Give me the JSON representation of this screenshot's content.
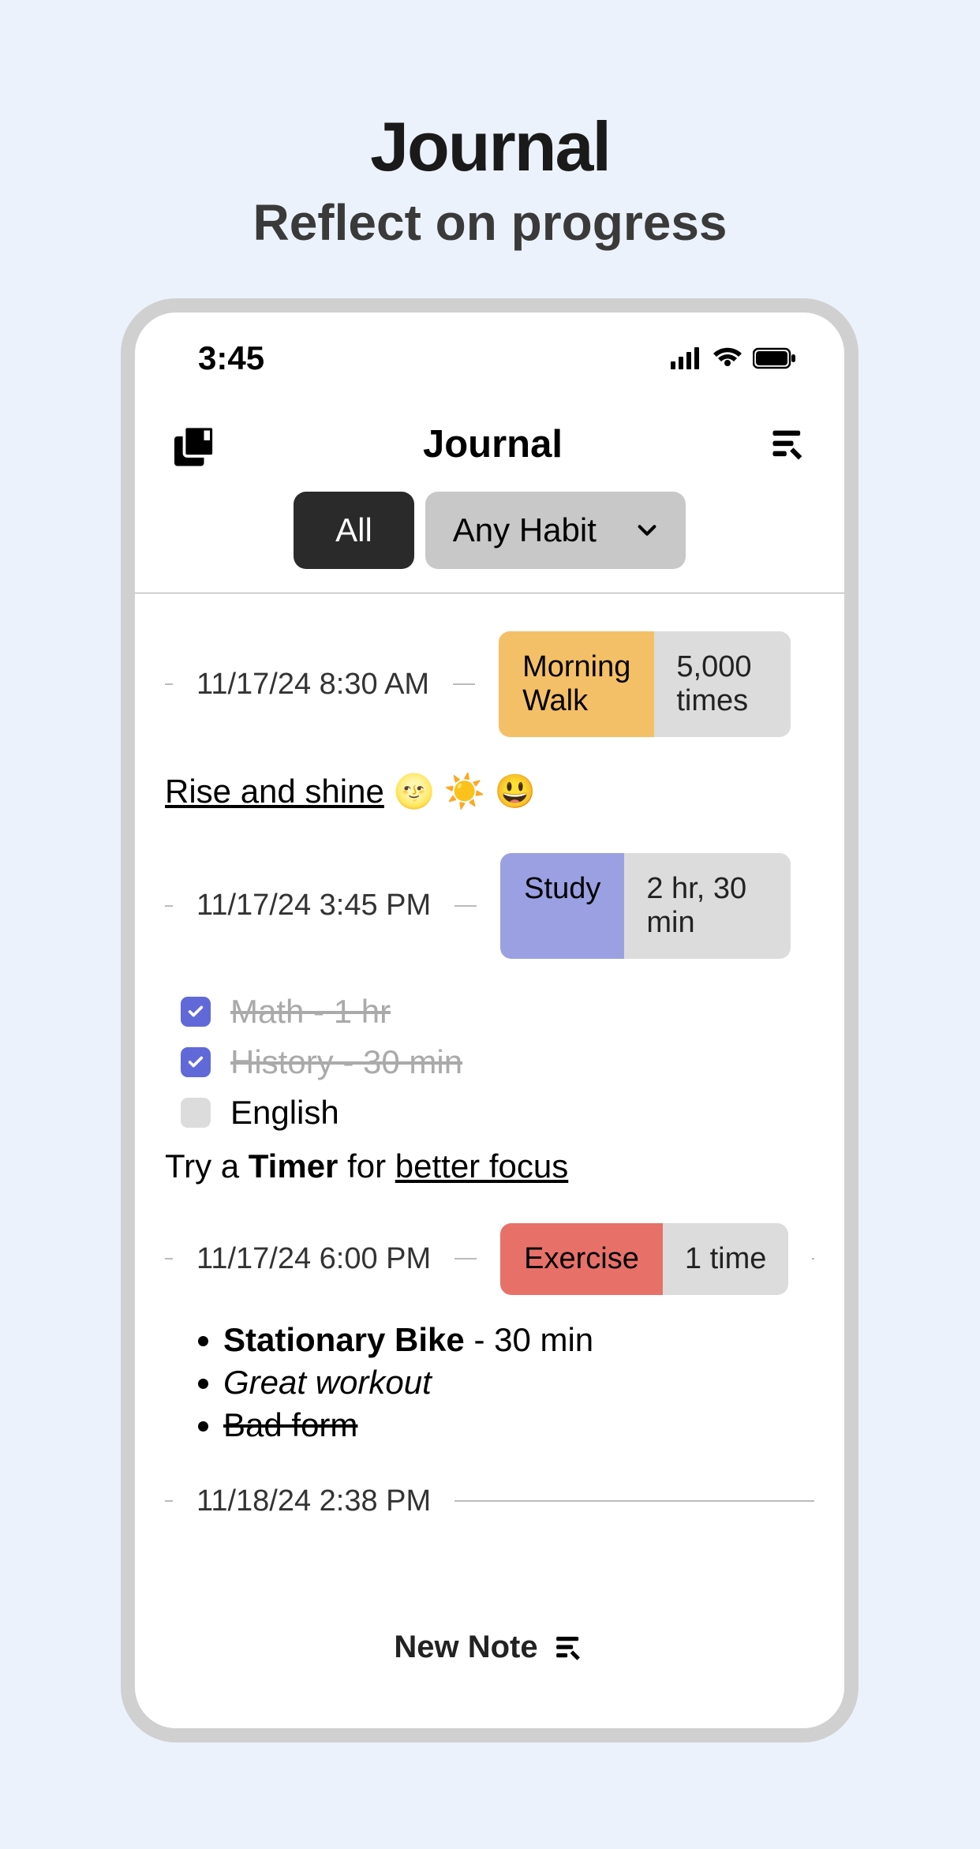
{
  "promo": {
    "title": "Journal",
    "subtitle": "Reflect on progress"
  },
  "status_bar": {
    "time": "3:45"
  },
  "header": {
    "title": "Journal"
  },
  "filters": {
    "all_label": "All",
    "habit_label": "Any Habit"
  },
  "entries": [
    {
      "timestamp": "11/17/24 8:30 AM",
      "tag": {
        "name": "Morning Walk",
        "value": "5,000 times",
        "color": "#f4c067"
      },
      "body_underline": "Rise and shine",
      "body_emoji": "🌝 ☀️ 😃"
    },
    {
      "timestamp": "11/17/24 3:45 PM",
      "tag": {
        "name": "Study",
        "value": "2 hr, 30 min",
        "color": "#9ba0e3"
      },
      "checklist": [
        {
          "label": "Math - 1 hr",
          "checked": true
        },
        {
          "label": "History - 30 min",
          "checked": true
        },
        {
          "label": "English",
          "checked": false
        }
      ],
      "tip_prefix": "Try a ",
      "tip_bold": "Timer",
      "tip_mid": " for ",
      "tip_underline": "better focus"
    },
    {
      "timestamp": "11/17/24 6:00 PM",
      "tag": {
        "name": "Exercise",
        "value": "1 time",
        "color": "#e77169"
      },
      "bullets": {
        "b1_bold": "Stationary Bike",
        "b1_rest": " - 30 min",
        "b2_italic": "Great workout",
        "b3_strike": "Bad form"
      }
    },
    {
      "timestamp": "11/18/24 2:38 PM"
    }
  ],
  "footer": {
    "new_note": "New Note"
  }
}
